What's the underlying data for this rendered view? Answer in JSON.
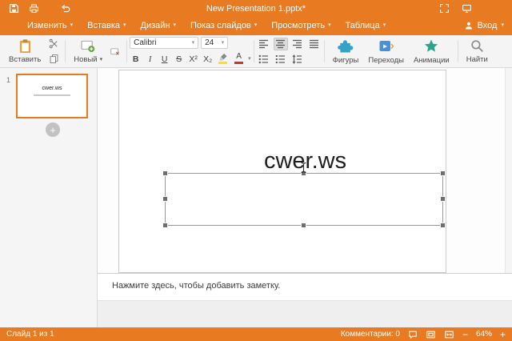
{
  "colors": {
    "accent_orange": "#E87A22",
    "toolbar_bg": "#F4F4F4",
    "highlight_yellow": "#FFE400",
    "font_color_red": "#D93025",
    "shapes_teal": "#35A3C7",
    "transitions_blue": "#4A90D9",
    "animations_teal": "#2AA58C",
    "selection_handle_gray": "#6E6E6E"
  },
  "titlebar": {
    "title": "New Presentation 1.pptx*"
  },
  "menubar": {
    "items": [
      {
        "label": "Изменить"
      },
      {
        "label": "Вставка"
      },
      {
        "label": "Дизайн"
      },
      {
        "label": "Показ слайдов"
      },
      {
        "label": "Просмотреть"
      },
      {
        "label": "Таблица"
      }
    ],
    "login": "Вход"
  },
  "toolbar": {
    "paste": "Вставить",
    "new_slide": "Новый",
    "font_name": "Calibri",
    "font_size": "24",
    "bold": "B",
    "italic": "I",
    "underline": "U",
    "strikethrough": "S",
    "superscript": "X²",
    "subscript": "X₂",
    "font_color_letter": "A",
    "shapes": "Фигуры",
    "transitions": "Переходы",
    "animations": "Анимации",
    "find": "Найти"
  },
  "slides_panel": {
    "slide_number": "1",
    "thumbnail_title": "cwer.ws",
    "add_glyph": "+"
  },
  "slide": {
    "title": "cwer.ws"
  },
  "notes": {
    "placeholder": "Нажмите здесь, чтобы добавить заметку."
  },
  "statusbar": {
    "slide_counter": "Слайд 1 из 1",
    "comments": "Комментарии: 0",
    "zoom_out": "−",
    "zoom": "64%",
    "zoom_in": "+"
  }
}
